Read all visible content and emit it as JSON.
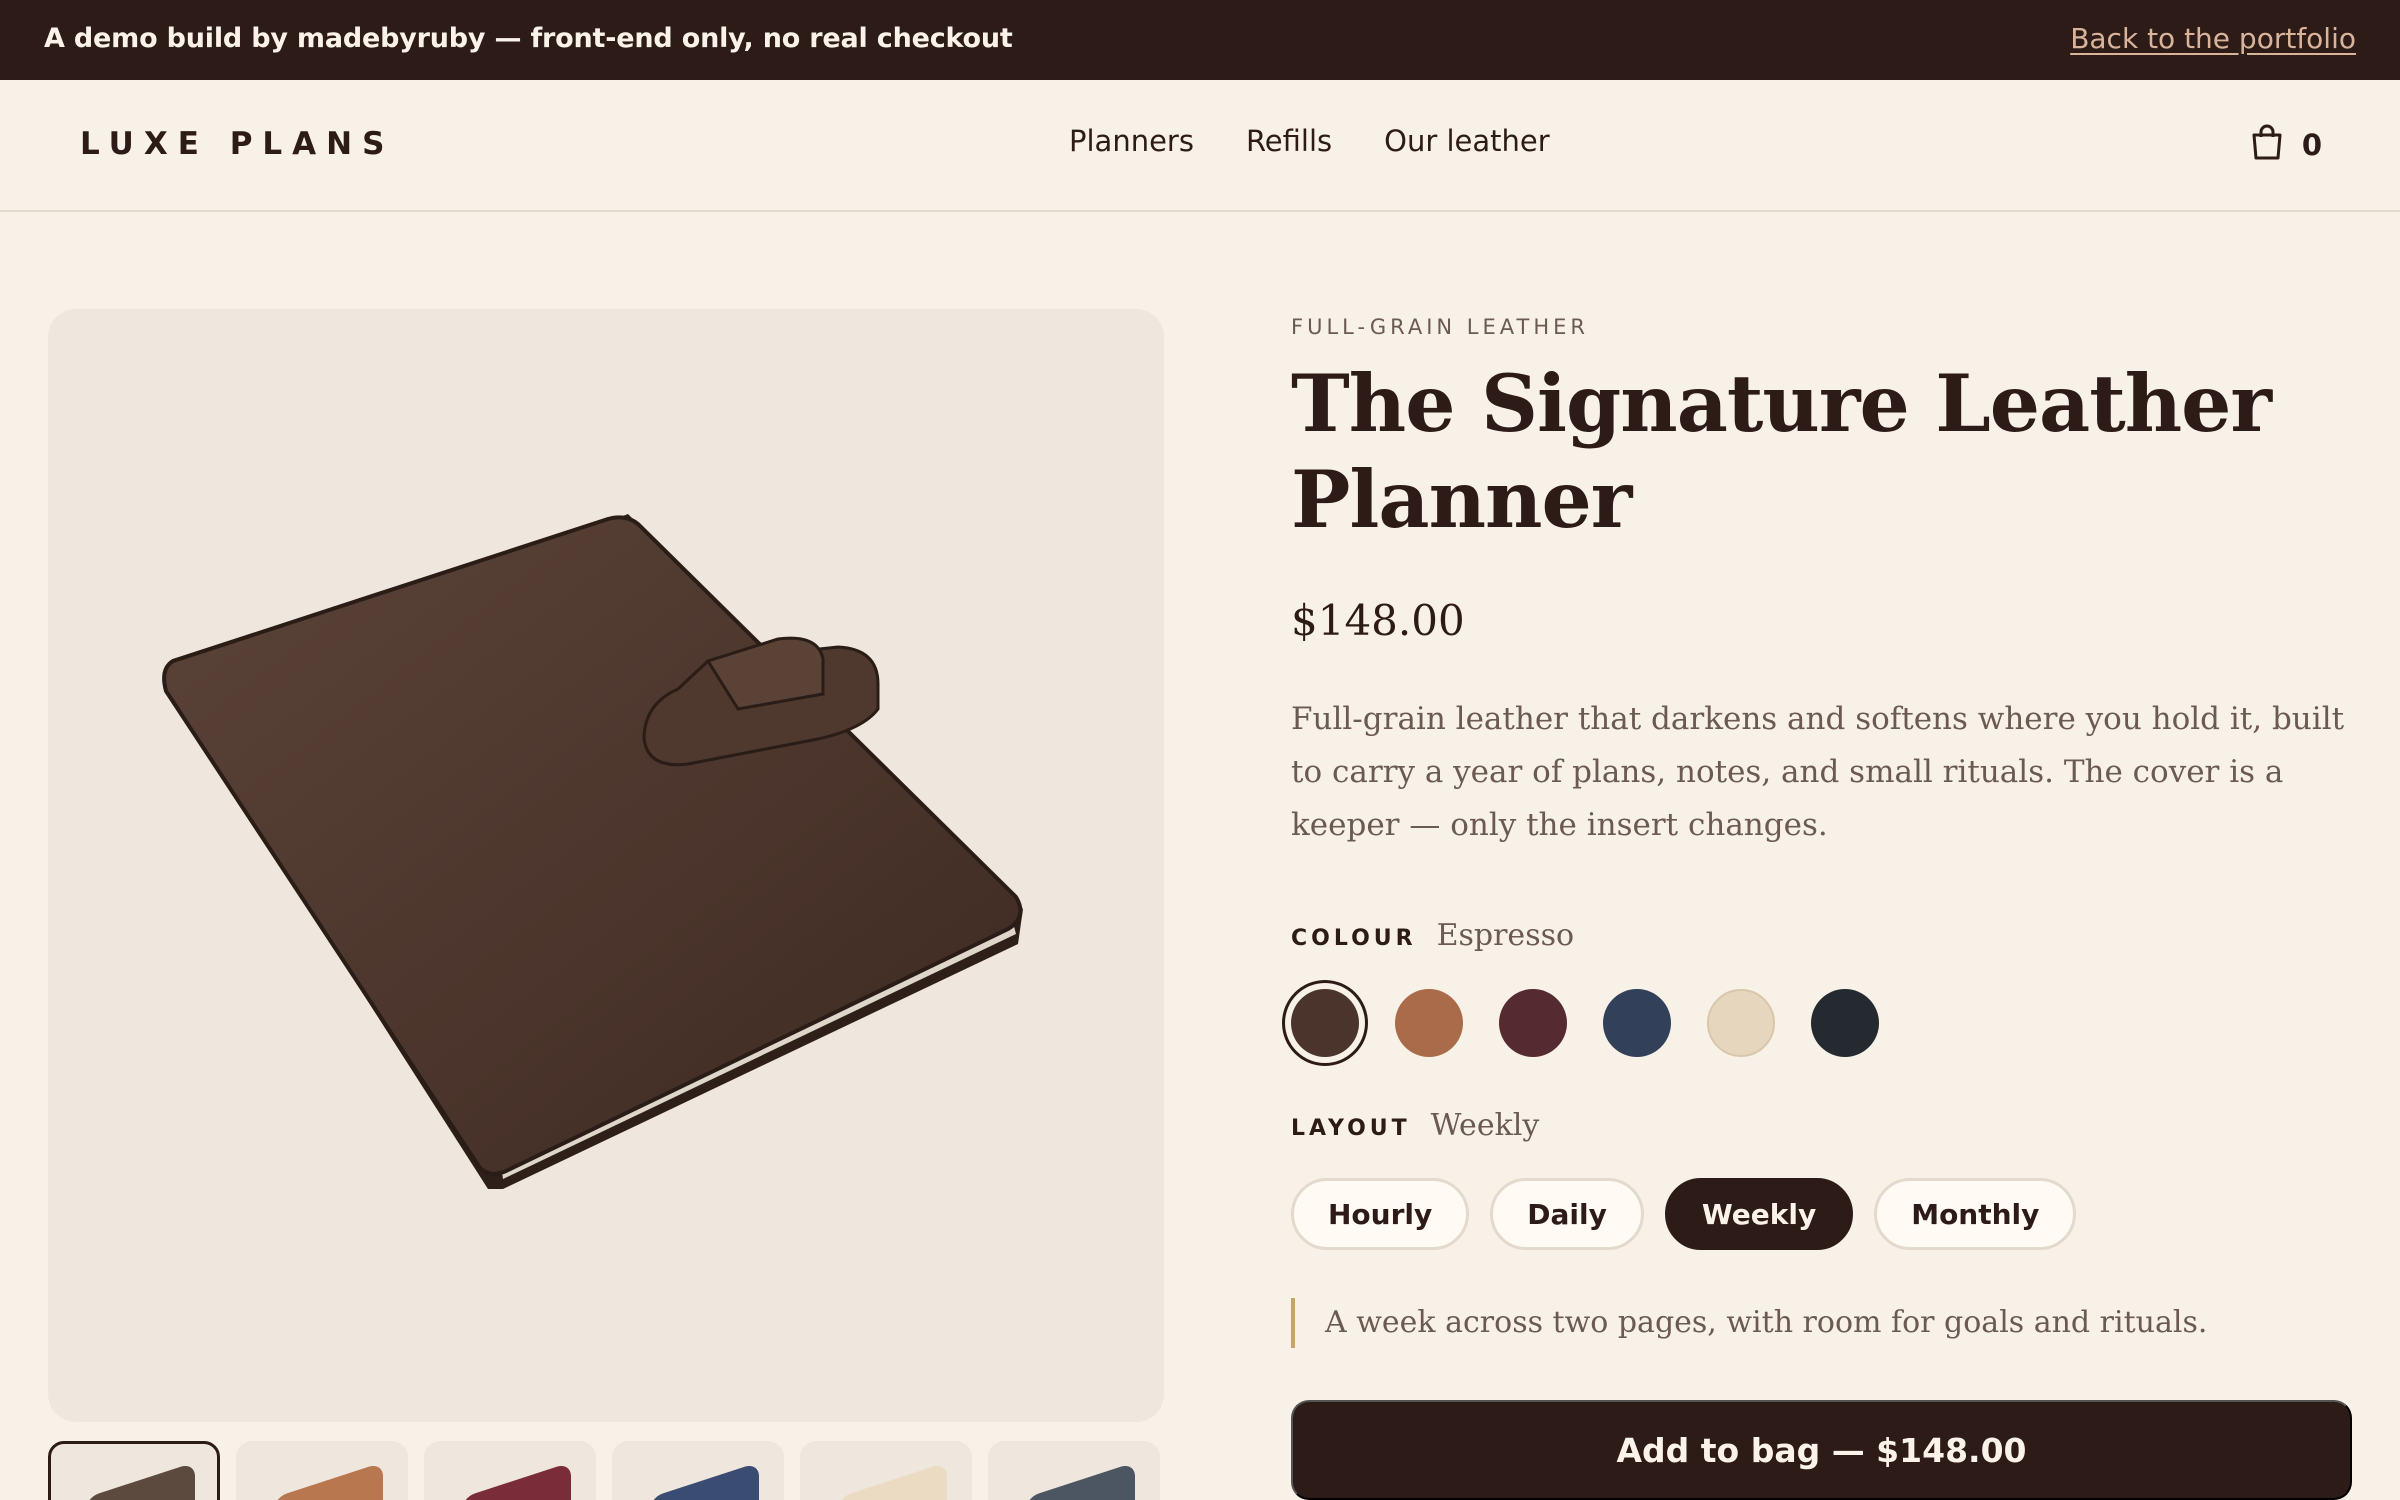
{
  "banner": {
    "text": "A demo build by madebyruby — front-end only, no real checkout",
    "link": "Back to the portfolio"
  },
  "nav": {
    "logo": "LUXE PLANS",
    "links": [
      "Planners",
      "Refills",
      "Our leather"
    ],
    "bag_icon": "shopping-bag-icon",
    "bag_count": "0"
  },
  "product": {
    "eyebrow": "FULL-GRAIN LEATHER",
    "title": "The Signature Leather Planner",
    "price": "$148.00",
    "description": "Full-grain leather that darkens and softens where you hold it, built to carry a year of plans, notes, and small rituals. The cover is a keeper — only the insert changes.",
    "colour": {
      "label": "COLOUR",
      "selected": "Espresso",
      "swatches": [
        "#4a342b",
        "#a96b4a",
        "#552a31",
        "#33405a",
        "#e6d6bd",
        "#252a31"
      ]
    },
    "layout": {
      "label": "LAYOUT",
      "selected": "Weekly",
      "options": [
        "Hourly",
        "Daily",
        "Weekly",
        "Monthly"
      ],
      "note": "A week across two pages, with room for goals and rituals."
    },
    "cta": "Add to bag — $148.00"
  },
  "gallery": {
    "thumb_colors": [
      "#5c4a3f",
      "#b8774f",
      "#7a2d38",
      "#3a4c72",
      "#eadbc2",
      "#4c5562"
    ]
  }
}
